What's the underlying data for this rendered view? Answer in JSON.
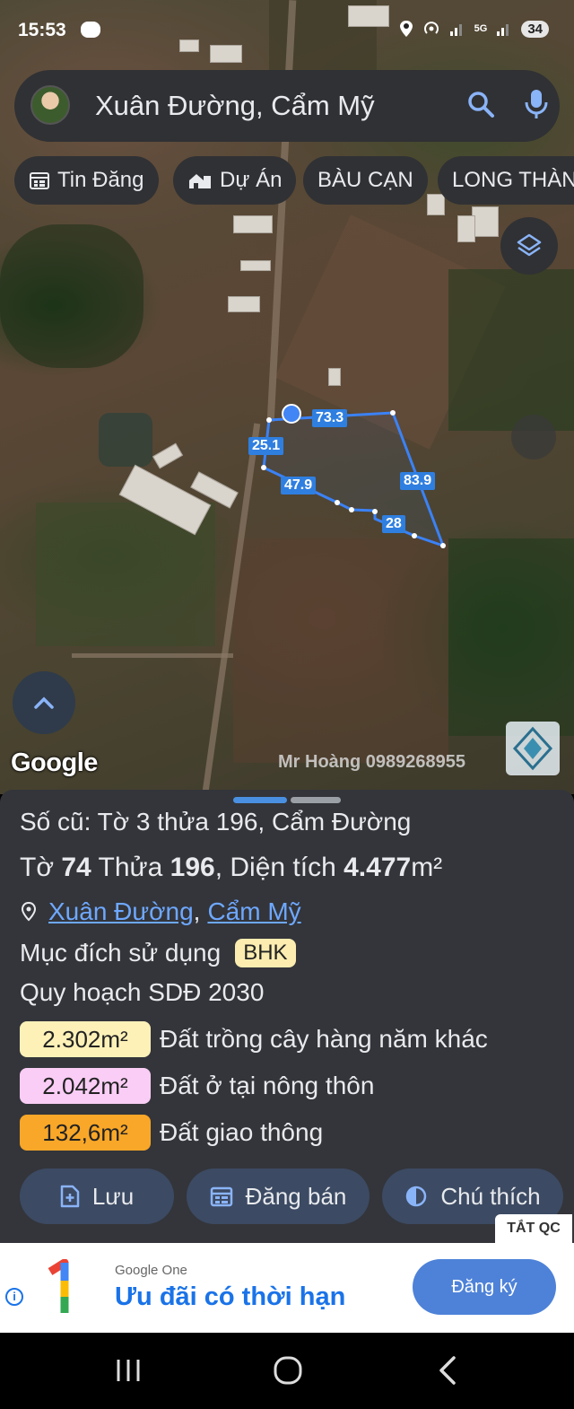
{
  "status": {
    "time": "15:53",
    "network": "5G",
    "battery": "34"
  },
  "search": {
    "query": "Xuân Đường, Cẩm Mỹ"
  },
  "chips": [
    {
      "label": "Tin Đăng",
      "icon": "calendar-icon"
    },
    {
      "label": "Dự Án",
      "icon": "house-icon"
    },
    {
      "label": "BÀU CẠN"
    },
    {
      "label": "LONG THÀN"
    }
  ],
  "map": {
    "provider": "Google",
    "watermark": "Mr Hoàng 0989268955",
    "measurements": [
      "73.3",
      "25.1",
      "83.9",
      "47.9",
      "28"
    ]
  },
  "parcel": {
    "old_info": "Số cũ: Tờ 3 thửa 196, Cẩm Đường",
    "sheet_label": "Tờ",
    "sheet_no": "74",
    "plot_label": "Thửa",
    "plot_no": "196",
    "area_label": ", Diện tích",
    "area": "4.477",
    "area_unit": "m²",
    "location_commune": "Xuân Đường",
    "location_sep": ",",
    "location_district": "Cẩm Mỹ",
    "purpose_label": "Mục đích sử dụng",
    "purpose_code": "BHK",
    "planning_label": "Quy hoạch SDĐ 2030",
    "planning": [
      {
        "value": "2.302m²",
        "label": "Đất trồng cây hàng năm khác",
        "color": "#fdf1b8"
      },
      {
        "value": "2.042m²",
        "label": "Đất ở tại nông thôn",
        "color": "#f9cdf5"
      },
      {
        "value": "132,6m²",
        "label": "Đất giao thông",
        "color": "#f9a728"
      }
    ]
  },
  "actions": {
    "save": "Lưu",
    "post_sale": "Đăng bán",
    "legend": "Chú thích"
  },
  "ad": {
    "close_label": "TẮT QC",
    "brand": "Google One",
    "title": "Ưu đãi có thời hạn",
    "cta": "Đăng ký"
  }
}
